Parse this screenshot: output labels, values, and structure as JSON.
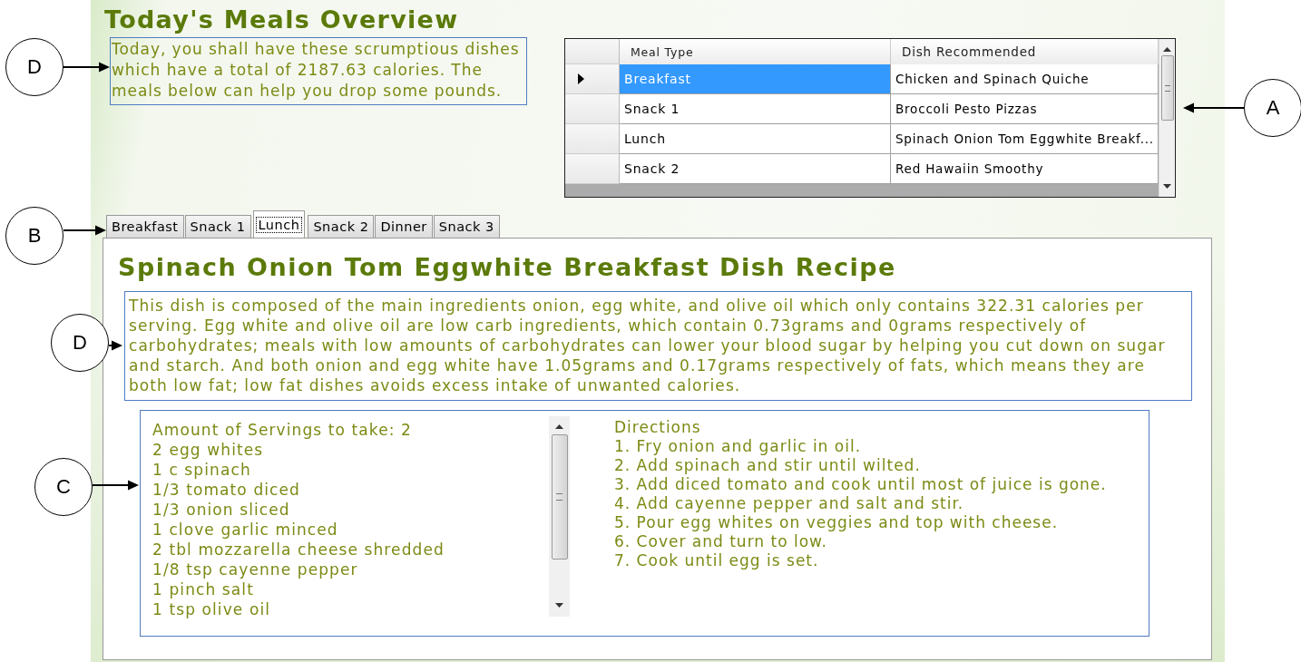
{
  "title": "Today's Meals Overview",
  "intro": "Today, you shall have these scrumptious dishes which have a total of 2187.63 calories. The meals below can help you drop some pounds.",
  "grid": {
    "columns": [
      "Meal Type",
      "Dish Recommended"
    ],
    "rows": [
      {
        "meal_type": "Breakfast",
        "dish": "Chicken and Spinach Quiche",
        "selected": true
      },
      {
        "meal_type": "Snack 1",
        "dish": "Broccoli Pesto Pizzas",
        "selected": false
      },
      {
        "meal_type": "Lunch",
        "dish": "Spinach Onion Tom Eggwhite Breakf...",
        "selected": false
      },
      {
        "meal_type": "Snack 2",
        "dish": "Red Hawaiin Smoothy",
        "selected": false
      }
    ]
  },
  "tabs": [
    {
      "label": "Breakfast",
      "selected": false
    },
    {
      "label": "Snack 1",
      "selected": false
    },
    {
      "label": "Lunch",
      "selected": true
    },
    {
      "label": "Snack 2",
      "selected": false
    },
    {
      "label": "Dinner",
      "selected": false
    },
    {
      "label": "Snack 3",
      "selected": false
    }
  ],
  "recipe": {
    "title": "Spinach Onion Tom Eggwhite Breakfast Dish Recipe",
    "description": "This dish is composed of the main ingredients onion, egg white, and olive oil which only contains 322.31 calories per serving. Egg white and olive oil are low carb ingredients, which contain 0.73grams and 0grams respectively of carbohydrates; meals with low amounts of carbohydrates can lower your blood sugar by helping you cut down on sugar and starch. And both onion and egg white have 1.05grams and 0.17grams respectively of fats, which means they are both low fat; low fat dishes avoids excess intake of unwanted calories.",
    "ingredients": [
      "Amount of Servings to take: 2",
      "2 egg whites",
      "1 c spinach",
      "1/3 tomato diced",
      "1/3 onion sliced",
      "1 clove garlic minced",
      "2 tbl mozzarella cheese shredded",
      "1/8 tsp cayenne pepper",
      "1 pinch salt",
      "1 tsp olive oil"
    ],
    "directions": [
      "Directions",
      "1. Fry onion and garlic in oil.",
      "2. Add spinach and stir until wilted.",
      "3. Add diced tomato and cook until most of juice is gone.",
      "4. Add cayenne pepper and salt and stir.",
      "5. Pour egg whites on veggies and top with cheese.",
      "6. Cover and turn to low.",
      "7. Cook until egg is set."
    ]
  },
  "callouts": [
    {
      "label": "D"
    },
    {
      "label": "A"
    },
    {
      "label": "B"
    },
    {
      "label": "D"
    },
    {
      "label": "C"
    }
  ]
}
